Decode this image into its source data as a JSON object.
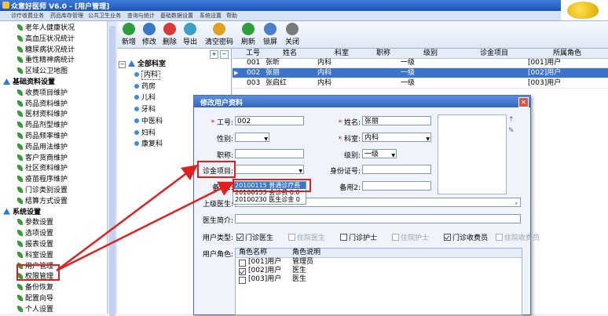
{
  "window": {
    "title": "众意好医师 V6.0 - [用户管理]",
    "menu": [
      "诊疗收费业务",
      "药品库存管理",
      "公共卫生业务",
      "查询与统计",
      "基础数据设置",
      "系统设置",
      "帮助"
    ]
  },
  "left_tree": {
    "items": [
      {
        "label": "老年人健康状况",
        "type": "leaf"
      },
      {
        "label": "高血压状况统计",
        "type": "leaf"
      },
      {
        "label": "糖尿病状况统计",
        "type": "leaf"
      },
      {
        "label": "重性精神病统计",
        "type": "leaf"
      },
      {
        "label": "区域公卫地图",
        "type": "leaf"
      },
      {
        "label": "基础资料设置",
        "type": "group"
      },
      {
        "label": "收费项目维护",
        "type": "leaf"
      },
      {
        "label": "药品资料维护",
        "type": "leaf"
      },
      {
        "label": "医材资料维护",
        "type": "leaf"
      },
      {
        "label": "药品剂型维护",
        "type": "leaf"
      },
      {
        "label": "药品频率维护",
        "type": "leaf"
      },
      {
        "label": "药品用法维护",
        "type": "leaf"
      },
      {
        "label": "客户货商维护",
        "type": "leaf"
      },
      {
        "label": "社区资料维护",
        "type": "leaf"
      },
      {
        "label": "疫苗程序维护",
        "type": "leaf"
      },
      {
        "label": "门诊类别设置",
        "type": "leaf"
      },
      {
        "label": "结算方式设置",
        "type": "leaf"
      },
      {
        "label": "系统设置",
        "type": "group"
      },
      {
        "label": "参数设置",
        "type": "leaf"
      },
      {
        "label": "选项设置",
        "type": "leaf"
      },
      {
        "label": "报表设置",
        "type": "leaf"
      },
      {
        "label": "科室设置",
        "type": "leaf"
      },
      {
        "label": "用户管理",
        "type": "leaf",
        "selected": true
      },
      {
        "label": "权限管理",
        "type": "leaf"
      },
      {
        "label": "备份恢复",
        "type": "leaf"
      },
      {
        "label": "配置向导",
        "type": "leaf"
      },
      {
        "label": "个人设置",
        "type": "leaf"
      }
    ]
  },
  "toolbar": {
    "buttons": [
      {
        "label": "新增",
        "icon": "add-icon",
        "color": "#2e9e3a"
      },
      {
        "label": "修改",
        "icon": "edit-icon",
        "color": "#3a78c8"
      },
      {
        "label": "删除",
        "icon": "delete-icon",
        "color": "#d83a3a"
      },
      {
        "label": "导出",
        "icon": "export-icon",
        "color": "#3aa0c8"
      },
      {
        "label": "清空密码",
        "icon": "clear-password-icon",
        "color": "#e0a020"
      },
      {
        "label": "刷新",
        "icon": "refresh-icon",
        "color": "#2e9e3a"
      },
      {
        "label": "锁屏",
        "icon": "lock-icon",
        "color": "#4a80c8"
      },
      {
        "label": "关闭",
        "icon": "close-icon",
        "color": "#7a7a7a"
      }
    ]
  },
  "dept_tree": {
    "root": "全部科室",
    "items": [
      "内科",
      "药房",
      "儿科",
      "牙科",
      "中医科",
      "妇科",
      "康复科"
    ],
    "selected": "内科"
  },
  "grid": {
    "columns": [
      "工号",
      "姓名",
      "科室",
      "职称",
      "级别",
      "诊金项目",
      "所属角色"
    ],
    "rows": [
      {
        "id": "001",
        "name": "张昕",
        "dept": "内科",
        "title": "",
        "level": "一级",
        "fee": "",
        "role": "[001]用户"
      },
      {
        "id": "002",
        "name": "张丽",
        "dept": "内科",
        "title": "",
        "level": "一级",
        "fee": "",
        "role": "[002]用户",
        "selected": true
      },
      {
        "id": "003",
        "name": "张启红",
        "dept": "内科",
        "title": "",
        "level": "一级",
        "fee": "",
        "role": "[003]用户"
      }
    ]
  },
  "dialog": {
    "title": "修改用户资料",
    "labels": {
      "id": "工号:",
      "name": "姓名:",
      "gender": "性别:",
      "dept": "科室:",
      "title": "职称:",
      "level": "级别:",
      "fee": "诊金项目:",
      "id_card": "身份证号:",
      "note1": "备用1:",
      "note2": "备用2:",
      "superior": "上级医生:",
      "intro": "医生简介:",
      "user_type": "用户类型:",
      "user_role": "用户角色:"
    },
    "values": {
      "id": "002",
      "name": "张丽",
      "gender": "",
      "dept": "内科",
      "title": "",
      "level": "一级",
      "fee": "",
      "id_card": "",
      "note1": "",
      "note2": "",
      "superior": "",
      "intro": ""
    },
    "fee_options": [
      "20100115 普通诊疗费",
      "20100153 会诊费 0.0",
      "20100230 医生诊金 0"
    ],
    "user_types": [
      {
        "label": "门诊医生",
        "checked": true,
        "enabled": true
      },
      {
        "label": "住院医生",
        "checked": false,
        "enabled": false
      },
      {
        "label": "门诊护士",
        "checked": false,
        "enabled": true
      },
      {
        "label": "住院护士",
        "checked": false,
        "enabled": false
      },
      {
        "label": "门诊收费员",
        "checked": true,
        "enabled": true
      },
      {
        "label": "住院收费员",
        "checked": false,
        "enabled": false
      }
    ],
    "role_columns": [
      "角色名称",
      "角色说明"
    ],
    "roles": [
      {
        "name": "[001]用户",
        "desc": "管理员",
        "checked": false
      },
      {
        "name": "[002]用户",
        "desc": "医生",
        "checked": true
      },
      {
        "name": "[003]用户",
        "desc": "医生",
        "checked": false
      }
    ]
  }
}
